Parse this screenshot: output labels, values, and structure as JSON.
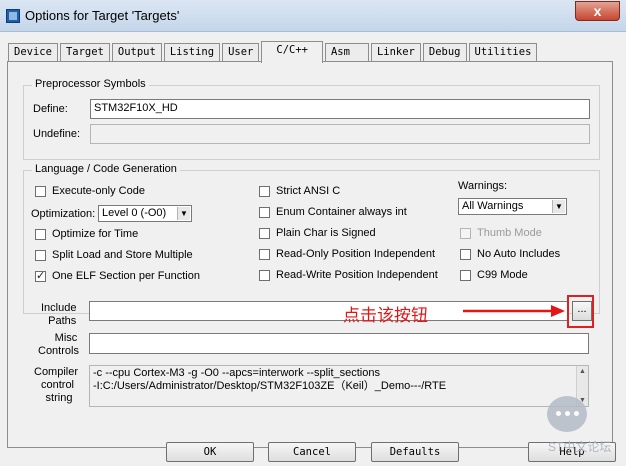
{
  "window": {
    "title": "Options for Target 'Targets'",
    "close_label": "x"
  },
  "tabs": [
    {
      "label": "Device"
    },
    {
      "label": "Target"
    },
    {
      "label": "Output"
    },
    {
      "label": "Listing"
    },
    {
      "label": "User"
    },
    {
      "label": "C/C++",
      "active": true
    },
    {
      "label": "Asm"
    },
    {
      "label": "Linker"
    },
    {
      "label": "Debug"
    },
    {
      "label": "Utilities"
    }
  ],
  "preprocessor": {
    "title": "Preprocessor Symbols",
    "define_label": "Define:",
    "define_value": "STM32F10X_HD",
    "undefine_label": "Undefine:",
    "undefine_value": ""
  },
  "language": {
    "title": "Language / Code Generation",
    "execute_only": {
      "label": "Execute-only Code",
      "checked": false
    },
    "optimization_label": "Optimization:",
    "optimization_value": "Level 0 (-O0)",
    "optimize_time": {
      "label": "Optimize for Time",
      "checked": false
    },
    "split_load": {
      "label": "Split Load and Store Multiple",
      "checked": false
    },
    "one_elf": {
      "label": "One ELF Section per Function",
      "checked": true
    },
    "strict_ansi": {
      "label": "Strict ANSI C",
      "checked": false
    },
    "enum_container": {
      "label": "Enum Container always int",
      "checked": false
    },
    "plain_char": {
      "label": "Plain Char is Signed",
      "checked": false
    },
    "ro_pos": {
      "label": "Read-Only Position Independent",
      "checked": false
    },
    "rw_pos": {
      "label": "Read-Write Position Independent",
      "checked": false
    },
    "warnings_label": "Warnings:",
    "warnings_value": "All Warnings",
    "thumb_mode": {
      "label": "Thumb Mode",
      "checked": false,
      "disabled": true
    },
    "no_auto_includes": {
      "label": "No Auto Includes",
      "checked": false
    },
    "c99_mode": {
      "label": "C99 Mode",
      "checked": false
    }
  },
  "include": {
    "label_line1": "Include",
    "label_line2": "Paths",
    "value": "",
    "browse_label": "...",
    "annotation": "点击该按钮"
  },
  "misc": {
    "label_line1": "Misc",
    "label_line2": "Controls",
    "value": ""
  },
  "compiler": {
    "label_line1": "Compiler",
    "label_line2": "control",
    "label_line3": "string",
    "line1": "-c --cpu Cortex-M3 -g -O0 --apcs=interwork --split_sections",
    "line2": "-I:C:/Users/Administrator/Desktop/STM32F103ZE（Keil）_Demo---/RTE"
  },
  "buttons": {
    "ok": "OK",
    "cancel": "Cancel",
    "defaults": "Defaults",
    "help": "Help"
  },
  "watermark": {
    "text": "ST中文论坛"
  },
  "colors": {
    "annotation_red": "#e31515",
    "title_bar": "#c5d6ea",
    "close_button": "#c7452f"
  }
}
